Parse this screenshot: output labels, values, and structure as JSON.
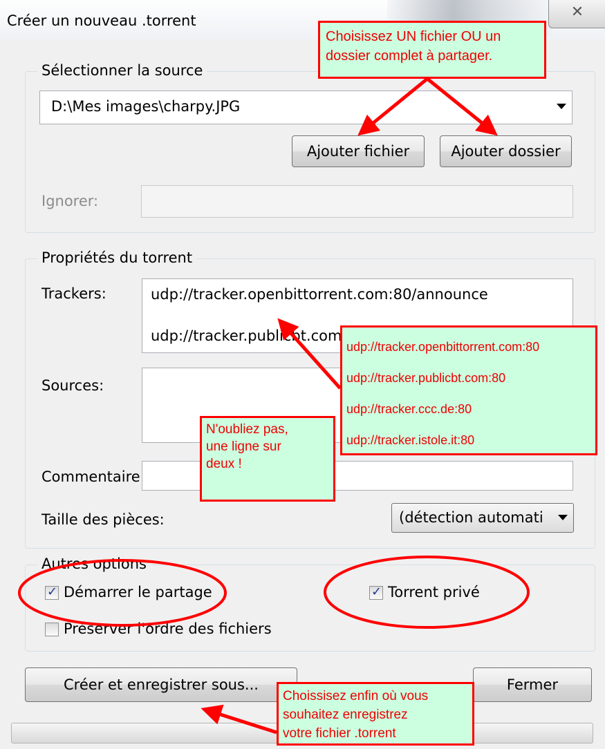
{
  "window": {
    "title": "Créer un nouveau .torrent",
    "close_label": "✕"
  },
  "source": {
    "legend": "Sélectionner la source",
    "path": "D:\\Mes images\\charpy.JPG",
    "add_file_label": "Ajouter fichier",
    "add_folder_label": "Ajouter dossier",
    "ignore_label": "Ignorer:",
    "ignore_value": ""
  },
  "properties": {
    "legend": "Propriétés du torrent",
    "trackers_label": "Trackers:",
    "trackers_line1": "udp://tracker.openbittorrent.com:80/announce",
    "trackers_line2": "udp://tracker.publicbt.com",
    "sources_label": "Sources:",
    "comment_label": "Commentaire",
    "comment_value": "",
    "piece_size_label": "Taille des pièces:",
    "piece_size_value": "(détection automati"
  },
  "options": {
    "legend": "Autres options",
    "start_seeding_label": "Démarrer le partage",
    "start_seeding_checked": true,
    "private_label": "Torrent privé",
    "private_checked": true,
    "preserve_order_label": "Préserver l'ordre des fichiers",
    "preserve_order_checked": false
  },
  "footer": {
    "create_label": "Créer et enregistrer sous...",
    "close_label": "Fermer"
  },
  "annotations": {
    "note_source": [
      "Choisissez UN fichier OU un",
      "dossier complet à partager."
    ],
    "tracker_list": [
      "udp://tracker.openbittorrent.com:80",
      "udp://tracker.publicbt.com:80",
      "udp://tracker.ccc.de:80",
      "udp://tracker.istole.it:80"
    ],
    "note_alternate": [
      "N'oubliez pas,",
      "une ligne sur",
      "deux !"
    ],
    "note_save": [
      "Choissisez enfin où vous",
      "souhaitez enregistrez",
      "votre fichier .torrent"
    ],
    "accent_color": "#ff0000",
    "note_background": "#ccffe0"
  }
}
